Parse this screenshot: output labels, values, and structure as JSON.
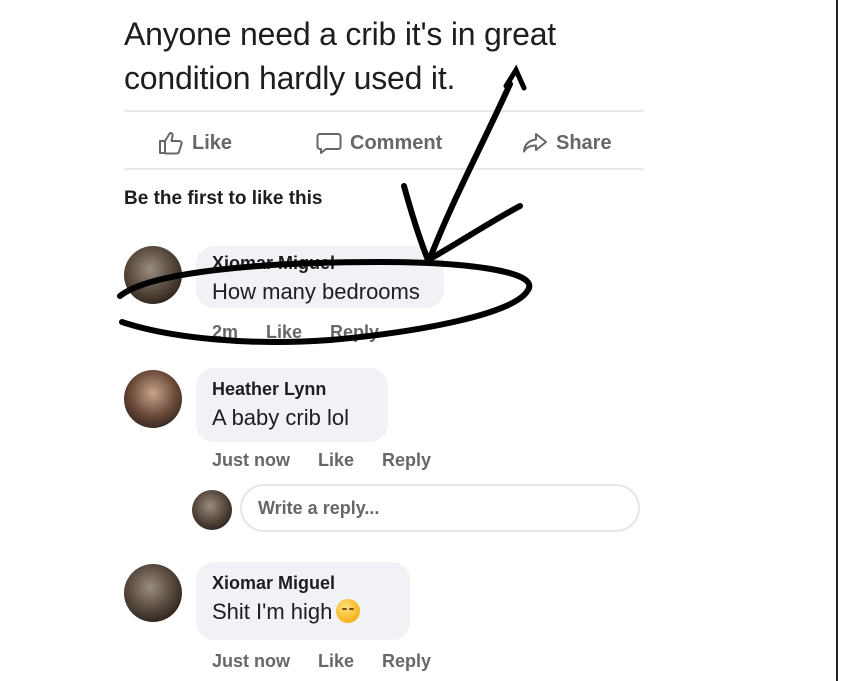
{
  "post": {
    "text": "Anyone need a crib it's in great condition hardly used it."
  },
  "actions": {
    "like": "Like",
    "comment": "Comment",
    "share": "Share"
  },
  "reactions_summary": "Be the first to like this",
  "comments": [
    {
      "name": "Xiomar Miguel",
      "text": "How many bedrooms",
      "time": "2m",
      "like": "Like",
      "reply": "Reply"
    },
    {
      "name": "Heather Lynn",
      "text": "A baby crib lol",
      "time": "Just now",
      "like": "Like",
      "reply": "Reply"
    },
    {
      "name": "Xiomar Miguel",
      "text": "Shit I'm high",
      "time": "Just now",
      "like": "Like",
      "reply": "Reply"
    }
  ],
  "reply_input": {
    "placeholder": "Write a reply..."
  },
  "icons": {
    "like": "thumbs-up-icon",
    "comment": "speech-bubble-icon",
    "share": "share-arrow-icon",
    "emoji": "smiling-emoji-icon"
  },
  "colors": {
    "text": "#1c1e21",
    "secondary": "#65676b",
    "bubble": "#f0f2f5",
    "annotation": "#000000"
  }
}
